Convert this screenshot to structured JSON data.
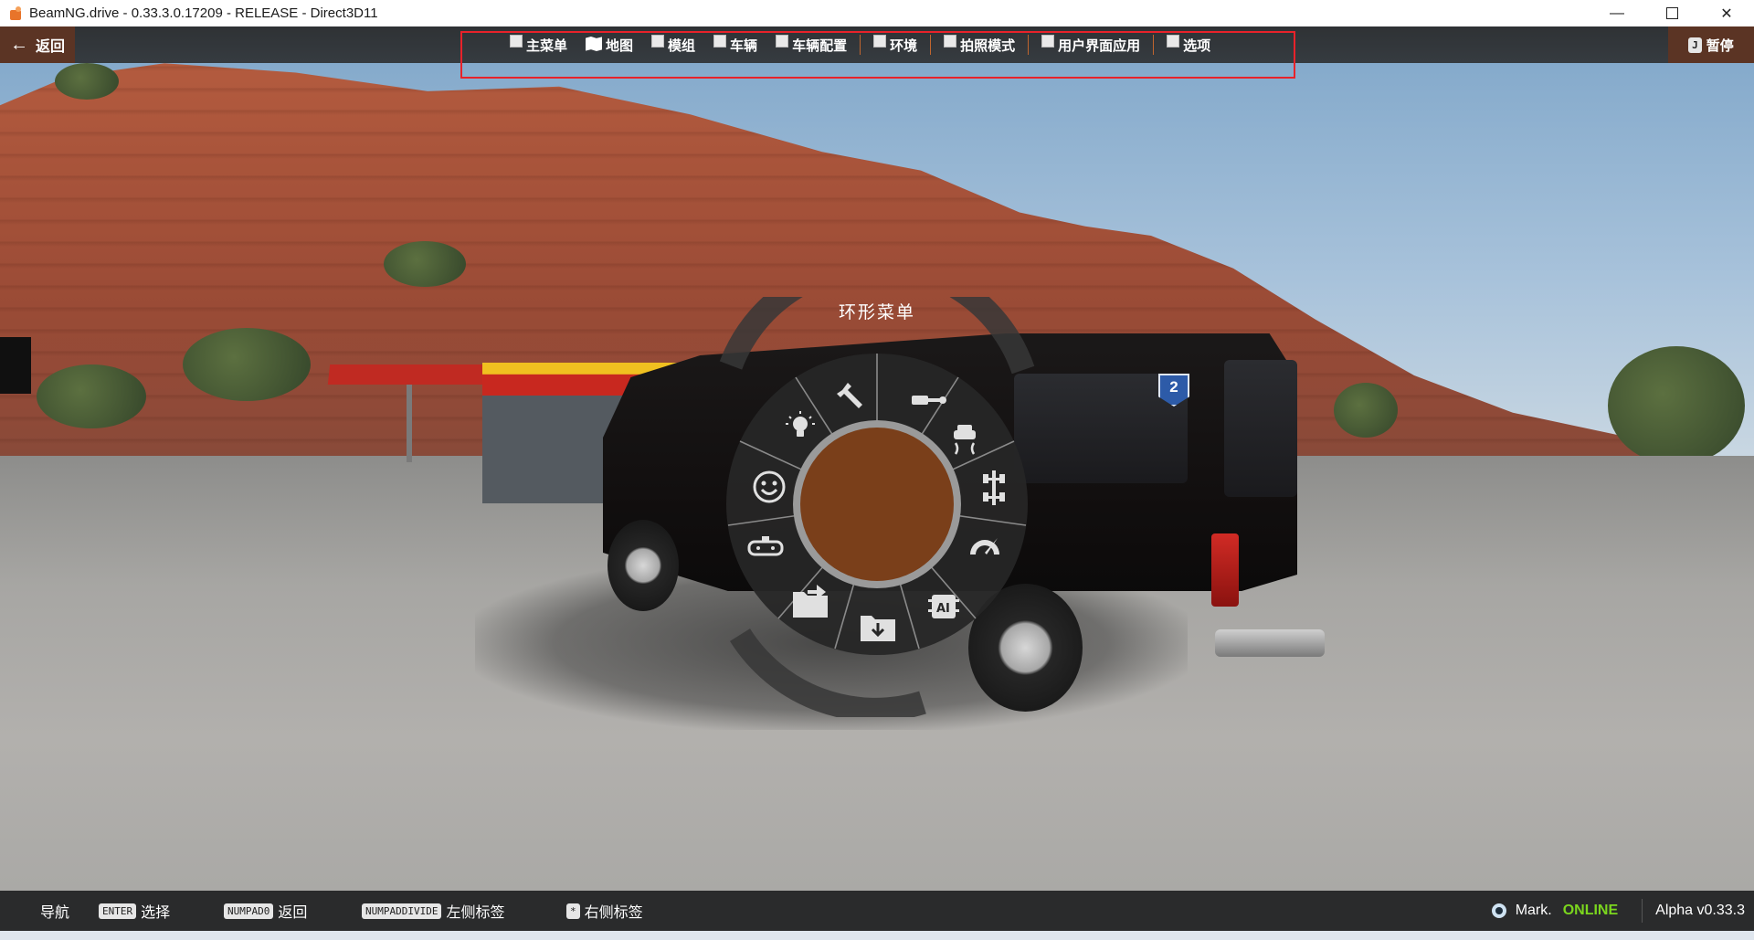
{
  "window": {
    "title": "BeamNG.drive - 0.33.3.0.17209 - RELEASE - Direct3D11",
    "controls": {
      "minimize": "—",
      "close": "✕"
    }
  },
  "topbar": {
    "back_label": "返回",
    "menu": [
      {
        "label": "主菜单",
        "icon": "broken-image-icon"
      },
      {
        "label": "地图",
        "icon": "map-icon"
      },
      {
        "label": "模组",
        "icon": "broken-image-icon"
      },
      {
        "label": "车辆",
        "icon": "broken-image-icon"
      },
      {
        "label": "车辆配置",
        "icon": "broken-image-icon"
      },
      {
        "label": "环境",
        "icon": "broken-image-icon"
      },
      {
        "label": "拍照模式",
        "icon": "broken-image-icon"
      },
      {
        "label": "用户界面应用",
        "icon": "broken-image-icon"
      },
      {
        "label": "选项",
        "icon": "broken-image-icon"
      }
    ],
    "pause_key": "J",
    "pause_label": "暂停",
    "highlight_color": "#e8222a"
  },
  "radial_menu": {
    "title": "环形菜单",
    "center_color": "#7a3f1a",
    "segments": [
      "wrench-icon",
      "tow-hitch-icon",
      "vehicle-traction-icon",
      "drivetrain-icon",
      "speedometer-icon",
      "ai-chip-icon",
      "load-folder-icon",
      "save-folder-icon",
      "vehicle-dash-icon",
      "smiley-icon",
      "lightbulb-icon"
    ]
  },
  "scene": {
    "vehicle_badge": "2"
  },
  "bottombar": {
    "hints": [
      {
        "key": "",
        "label": "导航"
      },
      {
        "key": "ENTER",
        "label": "选择"
      },
      {
        "key": "NUMPAD0",
        "label": "返回"
      },
      {
        "key": "NUMPADDIVIDE",
        "label": "左侧标签"
      },
      {
        "key": "*",
        "label": "右侧标签"
      }
    ],
    "user": "Mark.",
    "status": "ONLINE",
    "status_color": "#7bd61e",
    "version": "Alpha v0.33.3"
  }
}
